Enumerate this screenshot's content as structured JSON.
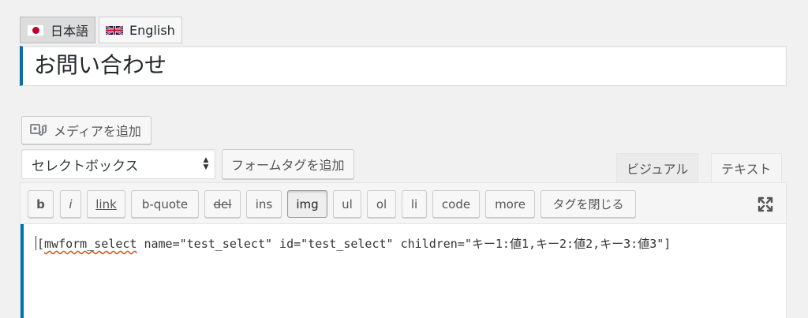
{
  "language_switcher": {
    "items": [
      {
        "label": "日本語",
        "active": true
      },
      {
        "label": "English",
        "active": false
      }
    ]
  },
  "post": {
    "title": "お問い合わせ"
  },
  "toolbar": {
    "add_media_label": "メディアを追加",
    "select_value": "セレクトボックス",
    "add_formtag_label": "フォームタグを追加"
  },
  "editor_tabs": {
    "visual": "ビジュアル",
    "text": "テキスト"
  },
  "quicktags": {
    "b": "b",
    "i": "i",
    "link": "link",
    "bquote": "b-quote",
    "del": "del",
    "ins": "ins",
    "img": "img",
    "ul": "ul",
    "ol": "ol",
    "li": "li",
    "code": "code",
    "more": "more",
    "close_tags": "タグを閉じる"
  },
  "content": {
    "open_bracket": "[",
    "shortcode_name": "mwform_select",
    "rest": " name=\"test_select\" id=\"test_select\" children=\"キー1:値1,キー2:値2,キー3:値3\"]"
  },
  "colors": {
    "accent": "#0073aa",
    "background": "#f1f1f1"
  }
}
